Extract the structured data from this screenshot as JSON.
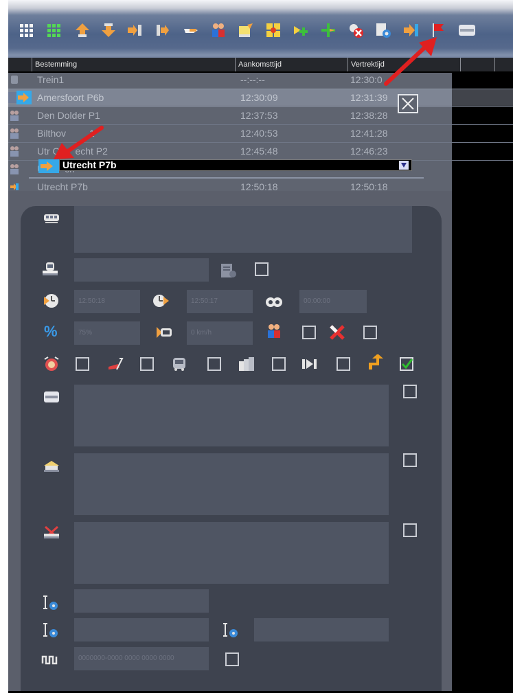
{
  "header": {
    "columns": [
      "Bestemming",
      "Aankomsttijd",
      "Vertrektijd"
    ]
  },
  "rows": [
    {
      "dest": "Trein1",
      "arr": "--:--:--",
      "dep": "12:30:0"
    },
    {
      "dest": "Amersfoort P6b",
      "arr": "12:30:09",
      "dep": "12:31:39"
    },
    {
      "dest": "Den Dolder P1",
      "arr": "12:37:53",
      "dep": "12:38:28"
    },
    {
      "dest": "Bilthov",
      "dest_suffix": "1",
      "arr": "12:40:53",
      "dep": "12:41:28"
    },
    {
      "dest": "Utr O",
      "dest_suffix": "echt P2",
      "arr": "12:45:48",
      "dep": "12:46:23"
    },
    {
      "dest": "U",
      "dest_suffix": "ch",
      "arr": "",
      "dep": ""
    },
    {
      "dest": "Utrecht P7b",
      "arr": "12:50:18",
      "dep": "12:50:18"
    }
  ],
  "dropdown": {
    "value": "Utrecht P7b"
  },
  "form": {
    "arrival_time": "12:50:18",
    "departure_time": "12:50:17",
    "dwell_time": "00:00:00",
    "percentage": "75%",
    "speed": "0 km/h",
    "code": "0000000-0000 0000 0000 0000"
  },
  "icons": {
    "toolbar": [
      "grid-white-icon",
      "grid-green-icon",
      "move-up-icon",
      "move-down-icon",
      "insert-after-icon",
      "insert-before-icon",
      "pointer-hand-icon",
      "passengers-icon",
      "sign-edit-icon",
      "junction-icon",
      "add-green-arrow-icon",
      "add-plus-icon",
      "remove-red-icon",
      "settings-doc-icon",
      "enter-arrow-icon",
      "flag-icon",
      "platform-icon"
    ]
  },
  "colors": {
    "accent_red": "#e02020",
    "check_green": "#2fbf2f"
  }
}
